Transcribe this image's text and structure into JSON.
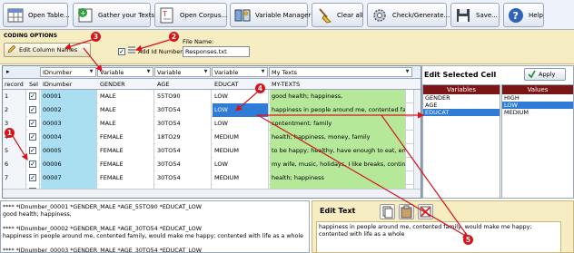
{
  "toolbar": {
    "open_table": "Open Table...",
    "gather_texts": "Gather your Texts",
    "open_corpus": "Open Corpus...",
    "variable_manager": "Variable Manager",
    "clear_all": "Clear all",
    "check_generate": "Check/Generate...",
    "save": "Save...",
    "help": "Help"
  },
  "coding": {
    "title": "CODING OPTIONS",
    "edit_column_names": "Edit Column Names",
    "add_id_numbers": "Add Id Numbers",
    "file_name_label": "File Name:",
    "file_name_value": "Responses.txt"
  },
  "grid": {
    "header1": [
      "IDnumber",
      "Variable",
      "Variable",
      "Variable",
      "My Texts"
    ],
    "header2": [
      "record",
      "Sel",
      "IDnumber",
      "GENDER",
      "AGE",
      "EDUCAT",
      "MY-TEXTS"
    ],
    "rows": [
      {
        "rec": "1",
        "sel": "✓",
        "id": "00001",
        "gender": "MALE",
        "age": "55TO90",
        "educat": "LOW",
        "text": "good health; happiness,"
      },
      {
        "rec": "2",
        "sel": "✓",
        "id": "00002",
        "gender": "MALE",
        "age": "30TO54",
        "educat": "LOW",
        "text": "happiness in people around me, contented family, would"
      },
      {
        "rec": "3",
        "sel": "✓",
        "id": "00003",
        "gender": "MALE",
        "age": "30TO54",
        "educat": "LOW",
        "text": "contentment; family"
      },
      {
        "rec": "4",
        "sel": "✓",
        "id": "00004",
        "gender": "FEMALE",
        "age": "18TO29",
        "educat": "MEDIUM",
        "text": "health; happiness, money, family"
      },
      {
        "rec": "5",
        "sel": "✓",
        "id": "00005",
        "gender": "FEMALE",
        "age": "30TO54",
        "educat": "MEDIUM",
        "text": "to be happy; healthy, have enough to eat, enough mo"
      },
      {
        "rec": "6",
        "sel": "✓",
        "id": "00006",
        "gender": "FEMALE",
        "age": "30TO54",
        "educat": "LOW",
        "text": "my wife, music, holidays, I like breaks, continuous goo"
      },
      {
        "rec": "7",
        "sel": "✓",
        "id": "00007",
        "gender": "FEMALE",
        "age": "30TO54",
        "educat": "MEDIUM",
        "text": "health; happiness"
      },
      {
        "rec": "8",
        "sel": "✓",
        "id": "00008",
        "gender": "FEMALE",
        "age": "30TO54",
        "educat": "LOW",
        "text": "to be healthy; just to live long enough to see the childr"
      }
    ]
  },
  "edit_cell": {
    "title": "Edit Selected Cell",
    "apply": "Apply",
    "variables_header": "Variables",
    "values_header": "Values",
    "variables": [
      "GENDER",
      "AGE",
      "EDUCAT"
    ],
    "values": [
      "HIGH",
      "LOW",
      "MEDIUM"
    ]
  },
  "output_lines": [
    "**** *IDnumber_00001 *GENDER_MALE *AGE_55TO90 *EDUCAT_LOW",
    "good health; happiness,",
    "",
    "**** *IDnumber_00002 *GENDER_MALE *AGE_30TO54 *EDUCAT_LOW",
    "happiness in people around me, contented family, would make me happy; contented with life as a whole",
    "",
    "**** *IDnumber_00003 *GENDER_MALE *AGE_30TO54 *EDUCAT_LOW"
  ],
  "edit_text": {
    "title": "Edit Text",
    "content": "happiness in people around me, contented family, would make me happy; contented with life as a whole"
  },
  "callouts": [
    "1",
    "2",
    "3",
    "4",
    "5"
  ],
  "colors": {
    "toolbar_bg": "#eef3fb",
    "coding_bg": "#f7edc3",
    "id_col": "#a9dff0",
    "text_col": "#b6e89a",
    "selected_cell": "#2f7bd8",
    "callout": "#d7141a",
    "header_dark": "#7a1616"
  }
}
